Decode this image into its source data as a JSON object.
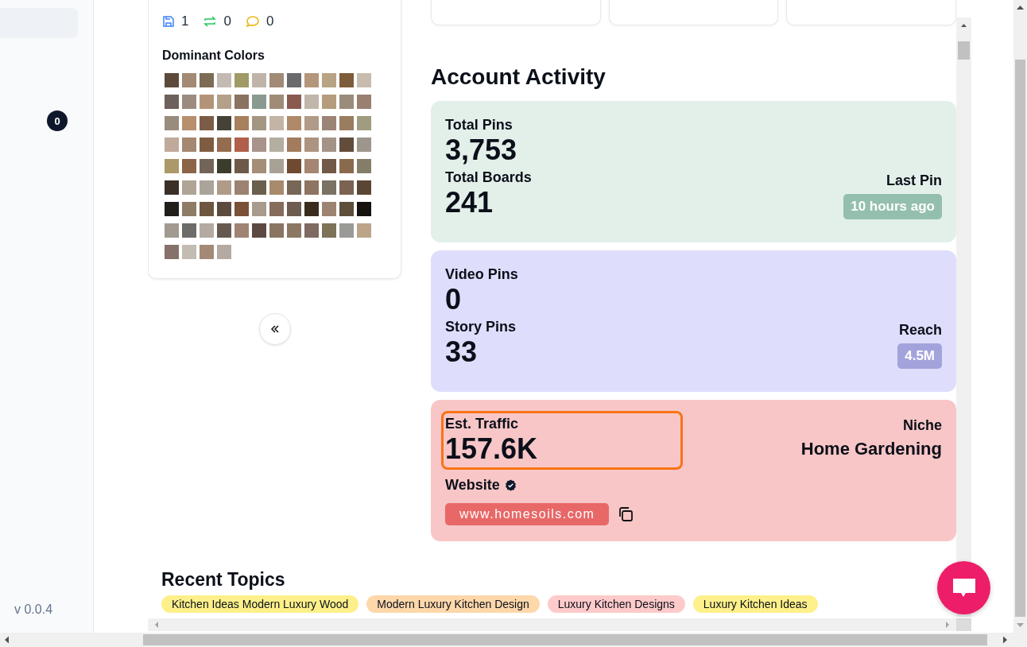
{
  "sidebar": {
    "badge": "0",
    "version": "v 0.0.4"
  },
  "pin_stats": [
    {
      "kind": "save",
      "value": "1"
    },
    {
      "kind": "repin",
      "value": "0"
    },
    {
      "kind": "comment",
      "value": "0"
    }
  ],
  "dominant_colors": {
    "title": "Dominant Colors",
    "swatches": [
      {
        "color": "#5e4a3a"
      },
      {
        "color": "#a38a74"
      },
      {
        "color": "#7c6c56"
      },
      {
        "color": "#c4bab4"
      },
      {
        "color": "#a09a66"
      },
      {
        "color": "#c0b4aa"
      },
      {
        "color": "#a18a76"
      },
      {
        "color": "#6a696e"
      },
      {
        "color": "#b4977a"
      },
      {
        "color": "#b8a484"
      },
      {
        "color": "#7e5c3a"
      },
      {
        "color": "#c8bcae"
      },
      {
        "color": "#6e605a"
      },
      {
        "color": "#9c8c80"
      },
      {
        "color": "#b49478"
      },
      {
        "color": "#b4a088"
      },
      {
        "color": "#8c7260"
      },
      {
        "color": "#8a9a90"
      },
      {
        "color": "#a08c76"
      },
      {
        "color": "#8a5a50"
      },
      {
        "color": "#c0b6aa"
      },
      {
        "color": "#b49c7c"
      },
      {
        "color": "#9a8c7a"
      },
      {
        "color": "#9a8070"
      },
      {
        "color": "#9a8c7c"
      },
      {
        "color": "#b8906e"
      },
      {
        "color": "#7c5c46"
      },
      {
        "color": "#464238"
      },
      {
        "color": "#a8805e"
      },
      {
        "color": "#a49680"
      },
      {
        "color": "#c4b4a6"
      },
      {
        "color": "#b08a68"
      },
      {
        "color": "#b09a88"
      },
      {
        "color": "#9c8476"
      },
      {
        "color": "#9a7c5e"
      },
      {
        "color": "#a09c80"
      },
      {
        "color": "#c0aa9c"
      },
      {
        "color": "#a48872"
      },
      {
        "color": "#7e5c42"
      },
      {
        "color": "#946c4e"
      },
      {
        "color": "#b0604a"
      },
      {
        "color": "#a8948a"
      },
      {
        "color": "#b4aea0"
      },
      {
        "color": "#a27c5c"
      },
      {
        "color": "#ac9480"
      },
      {
        "color": "#a49488"
      },
      {
        "color": "#624c3a"
      },
      {
        "color": "#9c968c"
      },
      {
        "color": "#ac9868"
      },
      {
        "color": "#8c6448"
      },
      {
        "color": "#726458"
      },
      {
        "color": "#3c3c2c"
      },
      {
        "color": "#6e5a4a"
      },
      {
        "color": "#a48e78"
      },
      {
        "color": "#a8a296"
      },
      {
        "color": "#6e4a30"
      },
      {
        "color": "#a48672"
      },
      {
        "color": "#725846"
      },
      {
        "color": "#8a6a4c"
      },
      {
        "color": "#847e68"
      },
      {
        "color": "#3a3028"
      },
      {
        "color": "#b0a496"
      },
      {
        "color": "#aaa49a"
      },
      {
        "color": "#b09a88"
      },
      {
        "color": "#9c8270"
      },
      {
        "color": "#6a5e4e"
      },
      {
        "color": "#a88a6c"
      },
      {
        "color": "#786656"
      },
      {
        "color": "#8e7462"
      },
      {
        "color": "#7a7262"
      },
      {
        "color": "#7c6252"
      },
      {
        "color": "#5a4634"
      },
      {
        "color": "#221e1a"
      },
      {
        "color": "#8e7c66"
      },
      {
        "color": "#6e5640"
      },
      {
        "color": "#5c4a3e"
      },
      {
        "color": "#7a5036"
      },
      {
        "color": "#a89a8c"
      },
      {
        "color": "#866c5a"
      },
      {
        "color": "#6e5c50"
      },
      {
        "color": "#3a2c1c"
      },
      {
        "color": "#9c8470"
      },
      {
        "color": "#5e4e3a"
      },
      {
        "color": "#161210"
      },
      {
        "color": "#a29a90"
      },
      {
        "color": "#6e6c6a"
      },
      {
        "color": "#b4aaa2"
      },
      {
        "color": "#665a50"
      },
      {
        "color": "#a08472"
      },
      {
        "color": "#5c4a42"
      },
      {
        "color": "#8a7462"
      },
      {
        "color": "#8c7664"
      },
      {
        "color": "#7e6a62"
      },
      {
        "color": "#7e7258"
      },
      {
        "color": "#9a9a96"
      },
      {
        "color": "#bca488"
      },
      {
        "color": "#86726a"
      },
      {
        "color": "#c2bcb2"
      },
      {
        "color": "#a48a76"
      },
      {
        "color": "#b4aaa2"
      }
    ]
  },
  "account_activity": {
    "title": "Account Activity",
    "cards": [
      {
        "color": "#e3f0ea",
        "primary": {
          "label": "Total Pins",
          "value": "3,753",
          "highlighted": false
        },
        "secondary": {
          "label": "Total Boards",
          "value": "241"
        },
        "side": {
          "kind": "badge",
          "label": "Last Pin",
          "value": "10 hours ago",
          "color": "#94bfae"
        }
      },
      {
        "color": "#dedefc",
        "primary": {
          "label": "Video Pins",
          "value": "0",
          "highlighted": false
        },
        "secondary": {
          "label": "Story Pins",
          "value": "33"
        },
        "side": {
          "kind": "badge",
          "label": "Reach",
          "value": "4.5M",
          "color": "#a3a3dc"
        }
      },
      {
        "color": "#f8c6c6",
        "primary": {
          "label": "Est. Traffic",
          "value": "157.6K",
          "highlighted": true
        },
        "website": {
          "label": "Website",
          "verified": true,
          "url": "www.homesoils.com",
          "color": "#e86868"
        },
        "side": {
          "kind": "text",
          "label": "Niche",
          "value": "Home Gardening"
        }
      }
    ]
  },
  "recent_topics": {
    "title": "Recent Topics",
    "topics": [
      {
        "label": "Kitchen Ideas Modern Luxury Wood",
        "color": "#fdf08a"
      },
      {
        "label": "Modern Luxury Kitchen Design",
        "color": "#fed7aa"
      },
      {
        "label": "Luxury Kitchen Designs",
        "color": "#fecaca"
      },
      {
        "label": "Luxury Kitchen Ideas",
        "color": "#fef08a"
      }
    ]
  }
}
